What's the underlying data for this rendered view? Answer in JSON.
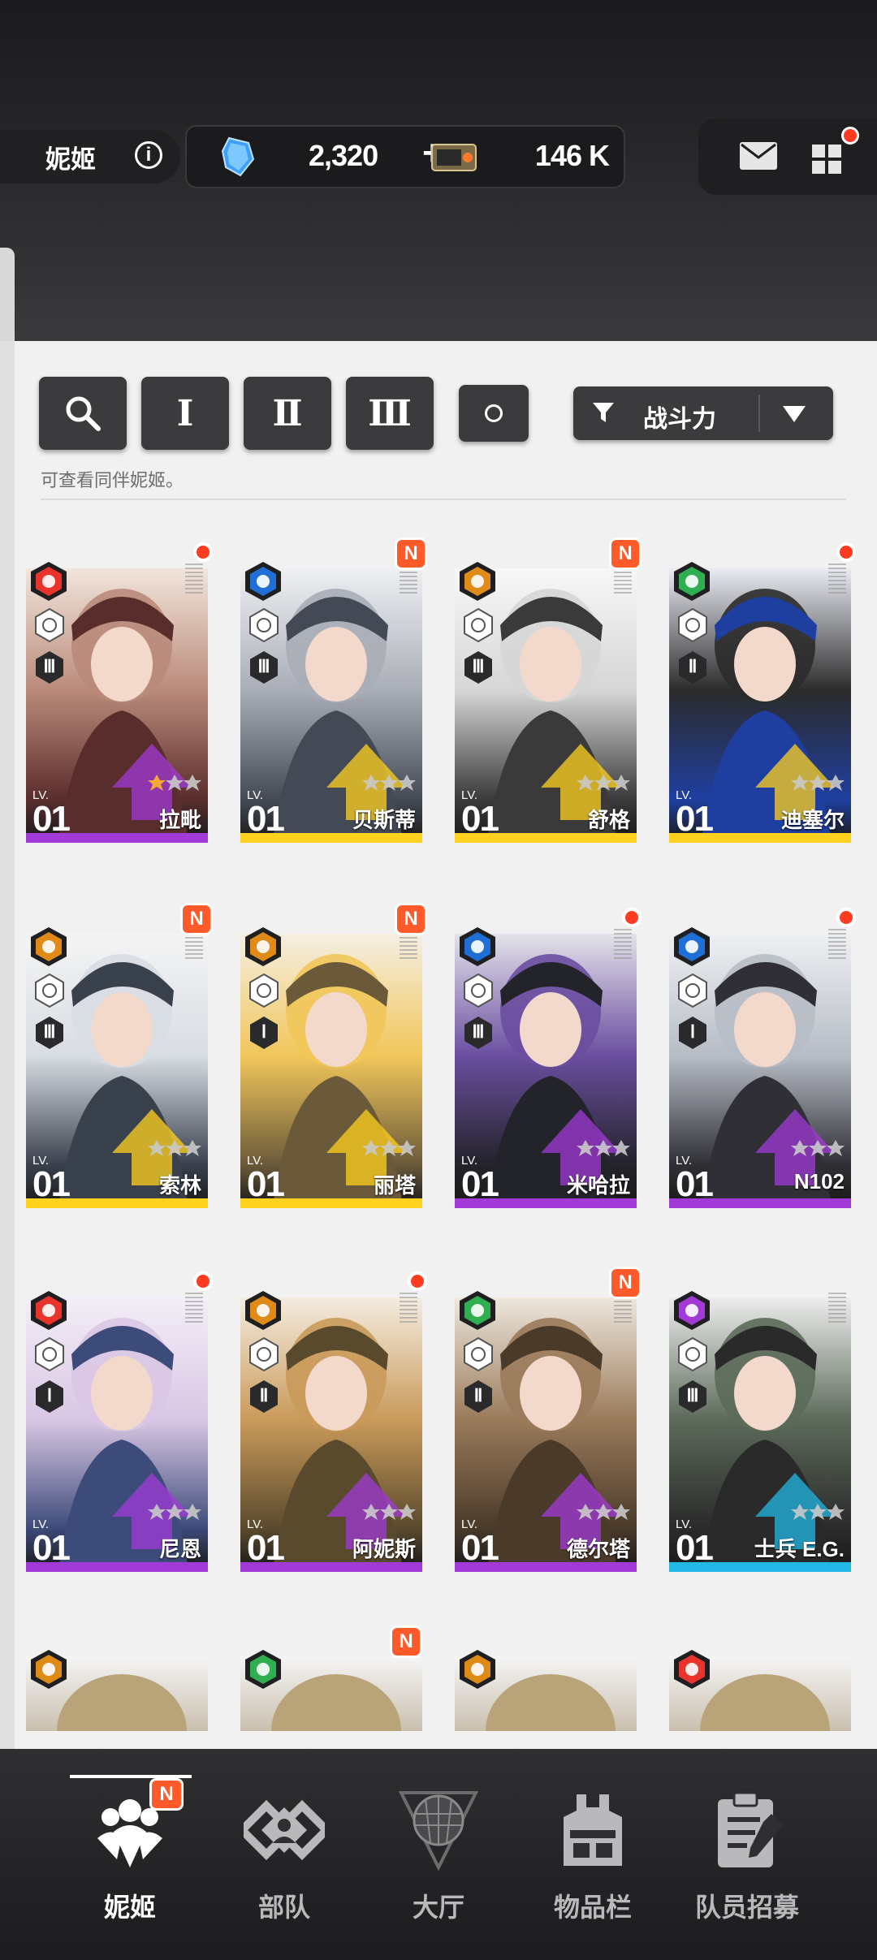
{
  "header": {
    "player_name": "妮姬",
    "gems": "2,320",
    "gems_plus": "+",
    "tickets": "146 K"
  },
  "filters": {
    "burst_1": "Ⅰ",
    "burst_2": "Ⅱ",
    "burst_3": "Ⅲ",
    "sort_label": "战斗力",
    "hint": "可查看同伴妮姬。"
  },
  "colors": {
    "fire": "#e8342c",
    "water": "#1f6fd6",
    "iron": "#e08a18",
    "wind": "#2fae52",
    "electric": "#a23ad8",
    "rarity_ssr": "#ffd21f",
    "rarity_sr": "#a23ad8",
    "rarity_r": "#22b7e6"
  },
  "cards": [
    {
      "name": "拉毗",
      "level_label": "LV.",
      "level": "01",
      "element": "fire",
      "burst": "Ⅲ",
      "rarity": "sr",
      "badge": "dot"
    },
    {
      "name": "贝斯蒂",
      "level_label": "LV.",
      "level": "01",
      "element": "water",
      "burst": "Ⅲ",
      "rarity": "ssr",
      "badge": "N"
    },
    {
      "name": "舒格",
      "level_label": "LV.",
      "level": "01",
      "element": "iron",
      "burst": "Ⅲ",
      "rarity": "ssr",
      "badge": "N"
    },
    {
      "name": "迪塞尔",
      "level_label": "LV.",
      "level": "01",
      "element": "wind",
      "burst": "Ⅱ",
      "rarity": "ssr",
      "badge": "dot"
    },
    {
      "name": "索林",
      "level_label": "LV.",
      "level": "01",
      "element": "iron",
      "burst": "Ⅲ",
      "rarity": "ssr",
      "badge": "N"
    },
    {
      "name": "丽塔",
      "level_label": "LV.",
      "level": "01",
      "element": "iron",
      "burst": "Ⅰ",
      "rarity": "ssr",
      "badge": "N"
    },
    {
      "name": "米哈拉",
      "level_label": "LV.",
      "level": "01",
      "element": "water",
      "burst": "Ⅲ",
      "rarity": "sr",
      "badge": "dot"
    },
    {
      "name": "N102",
      "level_label": "LV.",
      "level": "01",
      "element": "water",
      "burst": "Ⅰ",
      "rarity": "sr",
      "badge": "dot"
    },
    {
      "name": "尼恩",
      "level_label": "LV.",
      "level": "01",
      "element": "fire",
      "burst": "Ⅰ",
      "rarity": "sr",
      "badge": "dot"
    },
    {
      "name": "阿妮斯",
      "level_label": "LV.",
      "level": "01",
      "element": "iron",
      "burst": "Ⅱ",
      "rarity": "sr",
      "badge": "dot"
    },
    {
      "name": "德尔塔",
      "level_label": "LV.",
      "level": "01",
      "element": "wind",
      "burst": "Ⅱ",
      "rarity": "sr",
      "badge": "N"
    },
    {
      "name": "士兵 E.G.",
      "level_label": "LV.",
      "level": "01",
      "element": "electric",
      "burst": "Ⅲ",
      "rarity": "r",
      "badge": "none"
    }
  ],
  "partial_cards": [
    {
      "element": "iron",
      "badge": "none"
    },
    {
      "element": "wind",
      "badge": "N"
    },
    {
      "element": "iron",
      "badge": "none"
    },
    {
      "element": "fire",
      "badge": "none"
    }
  ],
  "nav": {
    "items": [
      "妮姬",
      "部队",
      "大厅",
      "物品栏",
      "队员招募"
    ],
    "badge": "N",
    "active": 0
  }
}
